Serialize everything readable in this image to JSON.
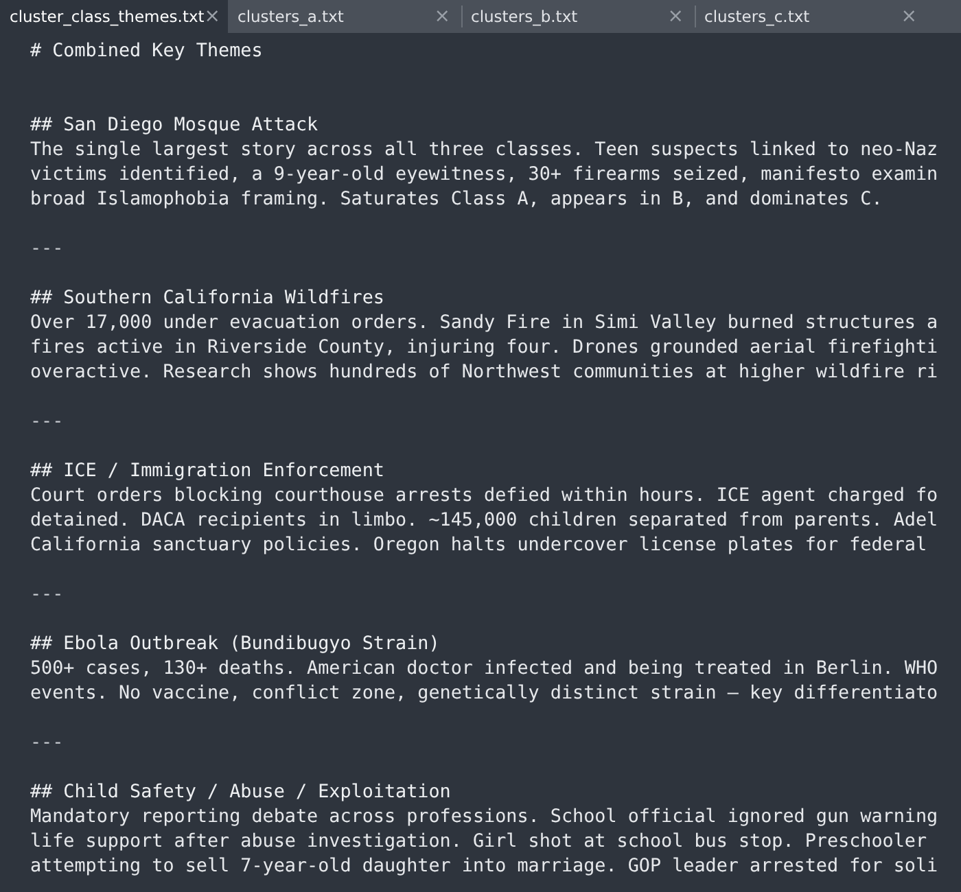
{
  "tabs": [
    {
      "label": "cluster_class_themes.txt",
      "selected": true,
      "close": "×"
    },
    {
      "label": "clusters_a.txt",
      "selected": false,
      "close": "×"
    },
    {
      "label": "clusters_b.txt",
      "selected": false,
      "close": "×"
    },
    {
      "label": "clusters_c.txt",
      "selected": false,
      "close": "×"
    }
  ],
  "editor": {
    "lines": [
      {
        "kind": "heading",
        "text": "# Combined Key Themes"
      },
      {
        "kind": "blank"
      },
      {
        "kind": "blank"
      },
      {
        "kind": "heading",
        "text": "## San Diego Mosque Attack"
      },
      {
        "kind": "text",
        "text": "The single largest story across all three classes. Teen suspects linked to neo-Naz"
      },
      {
        "kind": "text",
        "text": "victims identified, a 9-year-old eyewitness, 30+ firearms seized, manifesto examin"
      },
      {
        "kind": "text",
        "text": "broad Islamophobia framing. Saturates Class A, appears in B, and dominates C."
      },
      {
        "kind": "blank"
      },
      {
        "kind": "rule",
        "text": "---"
      },
      {
        "kind": "blank"
      },
      {
        "kind": "heading",
        "text": "## Southern California Wildfires"
      },
      {
        "kind": "text",
        "text": "Over 17,000 under evacuation orders. Sandy Fire in Simi Valley burned structures a"
      },
      {
        "kind": "text",
        "text": "fires active in Riverside County, injuring four. Drones grounded aerial firefighti"
      },
      {
        "kind": "text",
        "text": "overactive. Research shows hundreds of Northwest communities at higher wildfire ri"
      },
      {
        "kind": "blank"
      },
      {
        "kind": "rule",
        "text": "---"
      },
      {
        "kind": "blank"
      },
      {
        "kind": "heading",
        "text": "## ICE / Immigration Enforcement"
      },
      {
        "kind": "text",
        "text": "Court orders blocking courthouse arrests defied within hours. ICE agent charged fo"
      },
      {
        "kind": "text",
        "text": "detained. DACA recipients in limbo. ~145,000 children separated from parents. Adel"
      },
      {
        "kind": "text",
        "text": "California sanctuary policies. Oregon halts undercover license plates for federal"
      },
      {
        "kind": "blank"
      },
      {
        "kind": "rule",
        "text": "---"
      },
      {
        "kind": "blank"
      },
      {
        "kind": "heading",
        "text": "## Ebola Outbreak (Bundibugyo Strain)"
      },
      {
        "kind": "text",
        "text": "500+ cases, 130+ deaths. American doctor infected and being treated in Berlin. WHO"
      },
      {
        "kind": "text",
        "text": "events. No vaccine, conflict zone, genetically distinct strain — key differentiato"
      },
      {
        "kind": "blank"
      },
      {
        "kind": "rule",
        "text": "---"
      },
      {
        "kind": "blank"
      },
      {
        "kind": "heading",
        "text": "## Child Safety / Abuse / Exploitation"
      },
      {
        "kind": "text",
        "text": "Mandatory reporting debate across professions. School official ignored gun warning"
      },
      {
        "kind": "text",
        "text": "life support after abuse investigation. Girl shot at school bus stop. Preschooler"
      },
      {
        "kind": "text",
        "text": "attempting to sell 7-year-old daughter into marriage. GOP leader arrested for soli"
      }
    ]
  }
}
